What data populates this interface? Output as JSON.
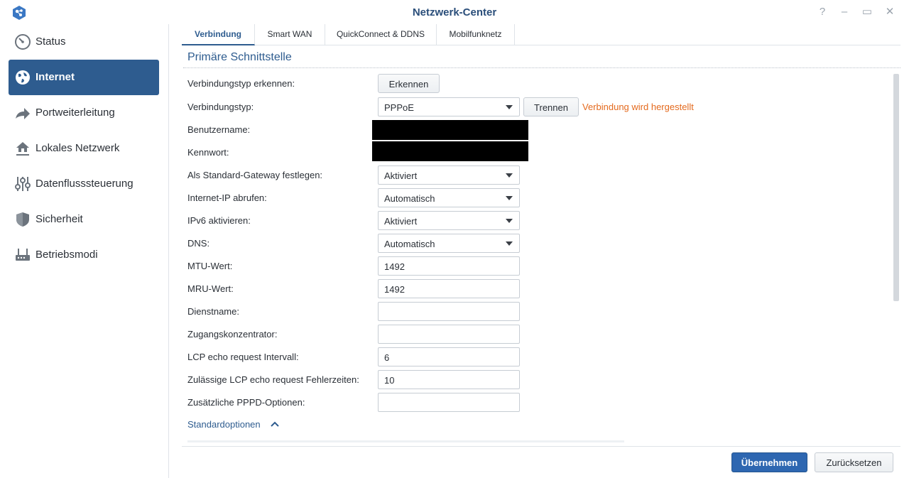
{
  "window": {
    "title": "Netzwerk-Center",
    "controls": {
      "help": "?",
      "minimize": "–",
      "maximize": "▭",
      "close": "✕"
    }
  },
  "sidebar": {
    "items": [
      {
        "label": "Status",
        "icon": "gauge-icon"
      },
      {
        "label": "Internet",
        "icon": "globe-icon",
        "active": true
      },
      {
        "label": "Portweiterleitung",
        "icon": "forward-arrow-icon"
      },
      {
        "label": "Lokales Netzwerk",
        "icon": "home-network-icon"
      },
      {
        "label": "Datenflusssteuerung",
        "icon": "sliders-icon"
      },
      {
        "label": "Sicherheit",
        "icon": "shield-icon"
      },
      {
        "label": "Betriebsmodi",
        "icon": "router-icon"
      }
    ]
  },
  "tabs": [
    {
      "label": "Verbindung",
      "active": true
    },
    {
      "label": "Smart WAN"
    },
    {
      "label": "QuickConnect & DDNS"
    },
    {
      "label": "Mobilfunknetz"
    }
  ],
  "section": {
    "title": "Primäre Schnittstelle"
  },
  "form": {
    "detect": {
      "label": "Verbindungstyp erkennen:",
      "button": "Erkennen"
    },
    "connection_type": {
      "label": "Verbindungstyp:",
      "value": "PPPoE",
      "disconnect_button": "Trennen",
      "status": "Verbindung wird hergestellt"
    },
    "username": {
      "label": "Benutzername:"
    },
    "password": {
      "label": "Kennwort:"
    },
    "default_gateway": {
      "label": "Als Standard-Gateway festlegen:",
      "value": "Aktiviert"
    },
    "internet_ip": {
      "label": "Internet-IP abrufen:",
      "value": "Automatisch"
    },
    "ipv6": {
      "label": "IPv6 aktivieren:",
      "value": "Aktiviert"
    },
    "dns": {
      "label": "DNS:",
      "value": "Automatisch"
    },
    "mtu": {
      "label": "MTU-Wert:",
      "value": "1492"
    },
    "mru": {
      "label": "MRU-Wert:",
      "value": "1492"
    },
    "service_name": {
      "label": "Dienstname:",
      "value": ""
    },
    "access_concentrator": {
      "label": "Zugangskonzentrator:",
      "value": ""
    },
    "lcp_interval": {
      "label": "LCP echo request Intervall:",
      "value": "6"
    },
    "lcp_failures": {
      "label": "Zulässige LCP echo request Fehlerzeiten:",
      "value": "10"
    },
    "pppd_options": {
      "label": "Zusätzliche PPPD-Optionen:",
      "value": ""
    }
  },
  "standard_options": {
    "label": "Standardoptionen"
  },
  "footer": {
    "apply": "Übernehmen",
    "reset": "Zurücksetzen"
  },
  "colors": {
    "accent": "#2e5c8f",
    "primary_button": "#2e67b1",
    "status": "#e46a1e"
  }
}
